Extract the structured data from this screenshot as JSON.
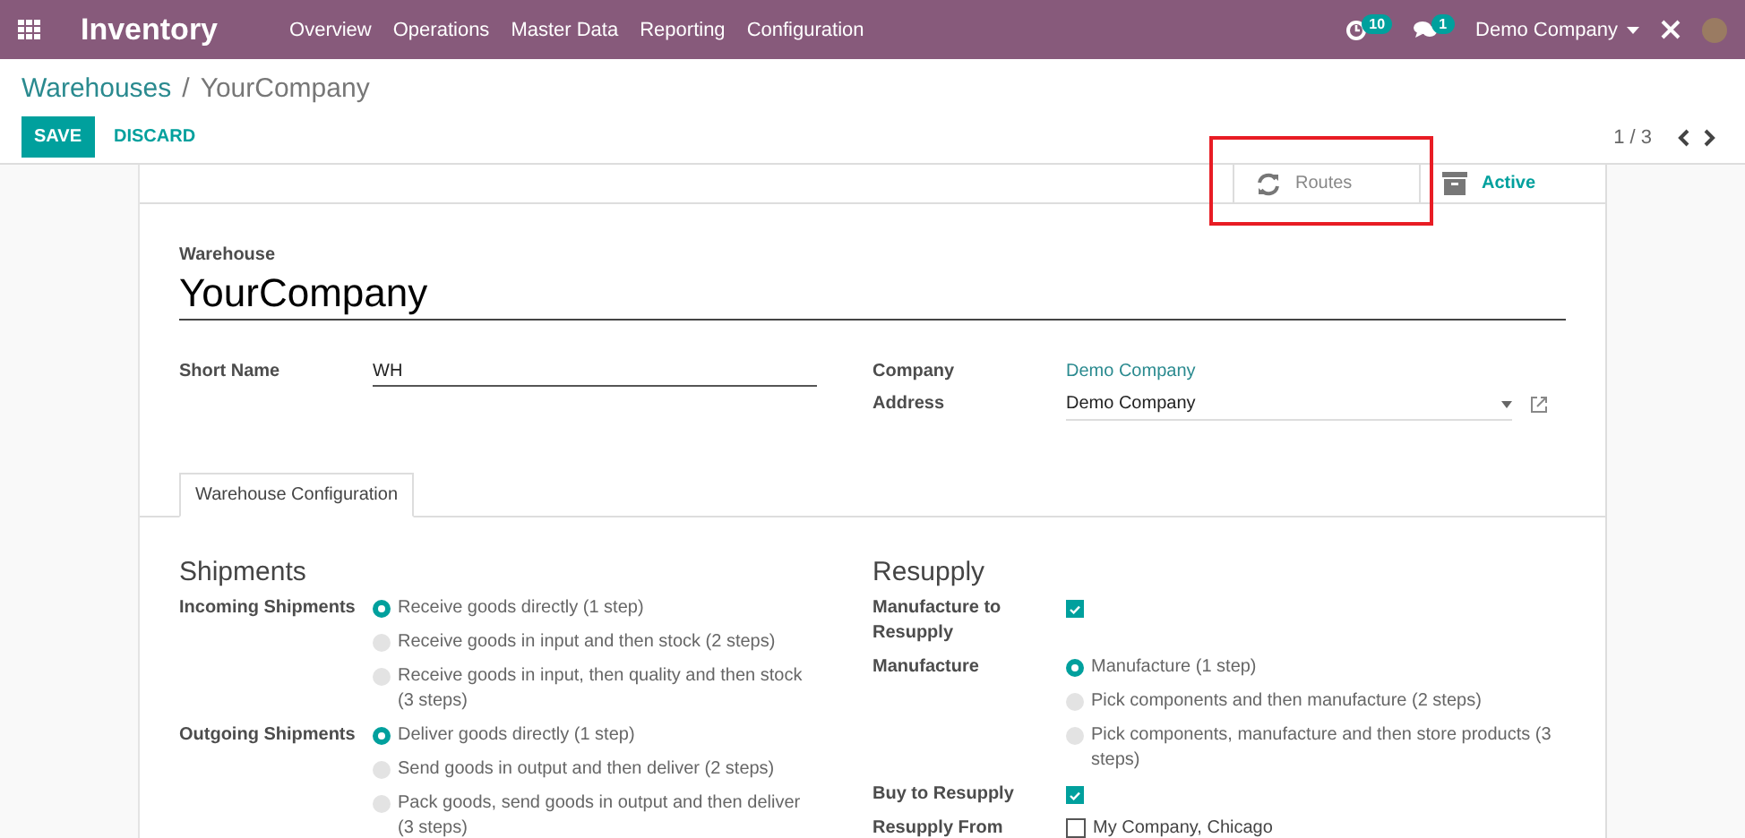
{
  "navbar": {
    "app_name": "Inventory",
    "menu": [
      "Overview",
      "Operations",
      "Master Data",
      "Reporting",
      "Configuration"
    ],
    "activity_count": "10",
    "message_count": "1",
    "company": "Demo Company"
  },
  "breadcrumb": {
    "parent": "Warehouses",
    "separator": "/",
    "current": "YourCompany"
  },
  "actions": {
    "save": "SAVE",
    "discard": "DISCARD"
  },
  "pager": "1 / 3",
  "smart_buttons": [
    {
      "kind": "routes",
      "label": "Routes",
      "highlighted": true
    },
    {
      "kind": "archive",
      "label": "Active",
      "highlighted": false
    }
  ],
  "form": {
    "name_label": "Warehouse",
    "name": "YourCompany",
    "short_name_label": "Short Name",
    "short_name": "WH",
    "company_label": "Company",
    "company": "Demo Company",
    "address_label": "Address",
    "address": "Demo Company"
  },
  "tabs": [
    {
      "label": "Warehouse Configuration",
      "selected": true
    }
  ],
  "shipments": {
    "title": "Shipments",
    "rows": [
      {
        "kind": "radio",
        "label": "Incoming Shipments",
        "options": [
          {
            "label": "Receive goods directly (1 step)",
            "selected": true
          },
          {
            "label": "Receive goods in input and then stock (2 steps)",
            "selected": false
          },
          {
            "label": "Receive goods in input, then quality and then stock (3 steps)",
            "selected": false
          }
        ]
      },
      {
        "kind": "radio",
        "label": "Outgoing Shipments",
        "options": [
          {
            "label": "Deliver goods directly (1 step)",
            "selected": true
          },
          {
            "label": "Send goods in output and then deliver (2 steps)",
            "selected": false
          },
          {
            "label": "Pack goods, send goods in output and then deliver (3 steps)",
            "selected": false
          }
        ]
      }
    ]
  },
  "resupply": {
    "title": "Resupply",
    "rows": [
      {
        "kind": "checkbox",
        "label": "Manufacture to Resupply",
        "checked": true
      },
      {
        "kind": "radio",
        "label": "Manufacture",
        "options": [
          {
            "label": "Manufacture (1 step)",
            "selected": true
          },
          {
            "label": "Pick components and then manufacture (2 steps)",
            "selected": false
          },
          {
            "label": "Pick components, manufacture and then store products (3 steps)",
            "selected": false
          }
        ]
      },
      {
        "kind": "checkbox",
        "label": "Buy to Resupply",
        "checked": true
      },
      {
        "kind": "checklist",
        "label": "Resupply From",
        "items": [
          {
            "label": "My Company, Chicago",
            "checked": false
          }
        ]
      }
    ]
  }
}
